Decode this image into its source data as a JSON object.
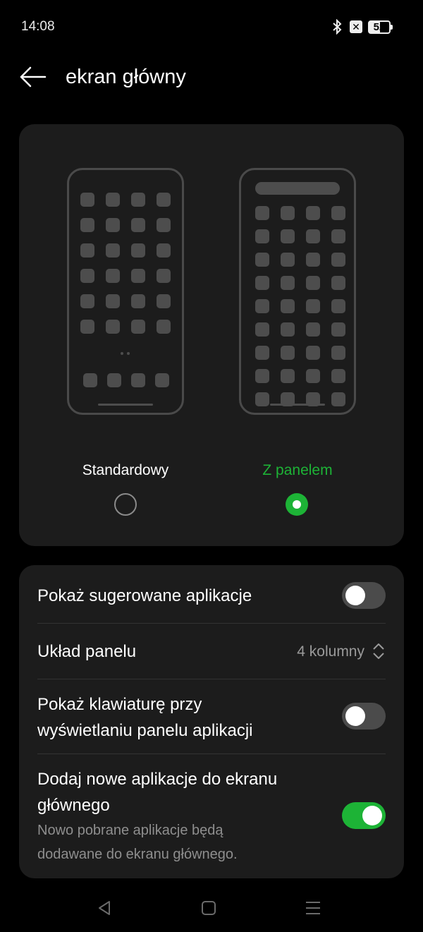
{
  "status_bar": {
    "time": "14:08",
    "battery": "52",
    "icons": [
      "bluetooth-icon",
      "no-sim-icon",
      "battery-icon"
    ]
  },
  "header": {
    "title": "ekran główny",
    "back_icon": "arrow-left-icon"
  },
  "layout_options": [
    {
      "label": "Standardowy",
      "selected": false
    },
    {
      "label": "Z panelem",
      "selected": true
    }
  ],
  "settings": {
    "suggested_apps": {
      "label": "Pokaż sugerowane aplikacje",
      "enabled": false
    },
    "panel_layout": {
      "label": "Układ panelu",
      "value": "4 kolumny"
    },
    "show_keyboard": {
      "label_line1": "Pokaż klawiaturę przy",
      "label_line2": "wyświetlaniu panelu aplikacji",
      "enabled": false
    },
    "add_new_apps": {
      "label_line1": "Dodaj nowe aplikacje do ekranu",
      "label_line2": "głównego",
      "desc_line1": "Nowo pobrane aplikacje będą",
      "desc_line2": "dodawane do ekranu głównego.",
      "enabled": true
    }
  },
  "colors": {
    "accent": "#1db336",
    "card": "#1c1c1c",
    "background": "#000000"
  },
  "navigation": [
    "back-triangle-icon",
    "home-square-icon",
    "recents-menu-icon"
  ]
}
